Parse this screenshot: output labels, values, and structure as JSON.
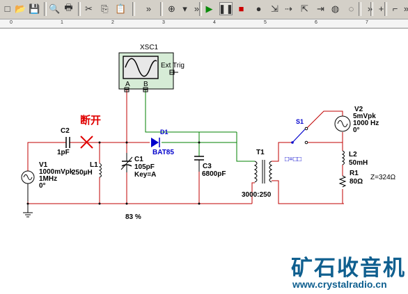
{
  "toolbar": {
    "buttons": [
      {
        "name": "new-icon",
        "glyph": "□"
      },
      {
        "name": "open-icon",
        "glyph": "📂"
      },
      {
        "name": "save-icon",
        "glyph": "💾"
      },
      {
        "name": "print-preview-icon",
        "glyph": "🔍"
      },
      {
        "name": "print-icon",
        "glyph": "🖶"
      },
      {
        "name": "cut-icon",
        "glyph": "✂"
      },
      {
        "name": "copy-icon",
        "glyph": "⎘"
      },
      {
        "name": "paste-icon",
        "glyph": "📋"
      },
      {
        "name": "more-icon",
        "glyph": "»"
      },
      {
        "name": "zoom-in-icon",
        "glyph": "⊕"
      },
      {
        "name": "dropdown-icon",
        "glyph": "▾"
      },
      {
        "name": "more-icon-2",
        "glyph": "»"
      },
      {
        "name": "run-icon",
        "glyph": "▶"
      },
      {
        "name": "pause-icon",
        "glyph": "❚❚"
      },
      {
        "name": "stop-icon",
        "glyph": "■"
      },
      {
        "name": "breakpoint-icon",
        "glyph": "●"
      },
      {
        "name": "step-into-icon",
        "glyph": "⇲"
      },
      {
        "name": "step-over-icon",
        "glyph": "⇢"
      },
      {
        "name": "step-out-icon",
        "glyph": "⇱"
      },
      {
        "name": "run-to-cursor-icon",
        "glyph": "⇥"
      },
      {
        "name": "toggle-breakpoint-icon",
        "glyph": "◍"
      },
      {
        "name": "remove-breakpoints-icon",
        "glyph": "◌"
      },
      {
        "name": "more-icon-3",
        "glyph": "»"
      },
      {
        "name": "add-icon",
        "glyph": "+"
      },
      {
        "name": "wire-icon",
        "glyph": "⌐"
      },
      {
        "name": "more-icon-4",
        "glyph": "»"
      }
    ]
  },
  "ruler": {
    "marks": [
      "0",
      "1",
      "2",
      "3",
      "4",
      "5",
      "6",
      "7"
    ]
  },
  "colors": {
    "wire_red": "#c00000",
    "wire_green": "#008000",
    "diode_blue": "#0000cc",
    "highlight_red": "#e00000"
  },
  "scope": {
    "name": "XSC1",
    "ext_trig": "Ext Trig",
    "ch_a": "A",
    "ch_b": "B"
  },
  "annotation": {
    "disconnect": "断开"
  },
  "c2": {
    "name": "C2",
    "value": "1pF"
  },
  "v1": {
    "name": "V1",
    "amp": "1000mVpk",
    "freq": "1MHz",
    "phase": "0°"
  },
  "l1": {
    "name": "L1",
    "value": "250µH"
  },
  "c1": {
    "name": "C1",
    "value": "105pF",
    "key": "Key=A",
    "percent": "83 %"
  },
  "d1": {
    "name": "D1",
    "model": "BAT85"
  },
  "c3": {
    "name": "C3",
    "value": "6800pF"
  },
  "t1": {
    "name": "T1",
    "ratio": "3000:250"
  },
  "s1": {
    "name": "S1",
    "key": "□=□□"
  },
  "v2": {
    "name": "V2",
    "amp": "5mVpk",
    "freq": "1000 Hz",
    "phase": "0°"
  },
  "l2": {
    "name": "L2",
    "value": "50mH"
  },
  "r1": {
    "name": "R1",
    "value": "80Ω"
  },
  "z_label": "Z=324Ω",
  "watermark": {
    "title": "矿石收音机",
    "url": "www.crystalradio.cn"
  }
}
